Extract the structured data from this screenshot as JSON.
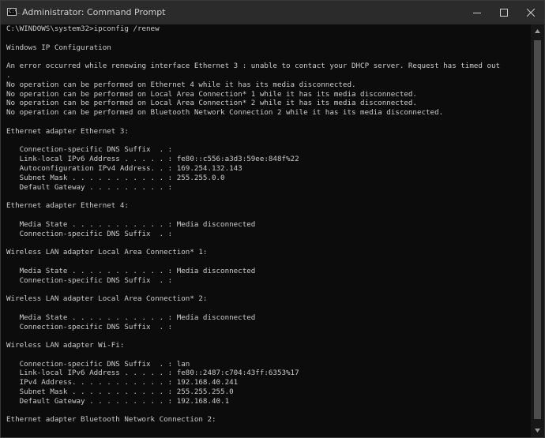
{
  "window": {
    "title": "Administrator: Command Prompt",
    "app_icon_glyph": "C:\\_",
    "icons": {
      "app": "command-prompt-icon",
      "minimize": "minimize-icon",
      "maximize": "maximize-icon",
      "close": "close-icon"
    }
  },
  "console": {
    "colors": {
      "background": "#0c0c0c",
      "text": "#cccccc",
      "titlebar": "#2b2b2b"
    },
    "lines": [
      "C:\\WINDOWS\\system32>ipconfig /renew",
      "",
      "Windows IP Configuration",
      "",
      "An error occurred while renewing interface Ethernet 3 : unable to contact your DHCP server. Request has timed out",
      ".",
      "No operation can be performed on Ethernet 4 while it has its media disconnected.",
      "No operation can be performed on Local Area Connection* 1 while it has its media disconnected.",
      "No operation can be performed on Local Area Connection* 2 while it has its media disconnected.",
      "No operation can be performed on Bluetooth Network Connection 2 while it has its media disconnected.",
      "",
      "Ethernet adapter Ethernet 3:",
      "",
      "   Connection-specific DNS Suffix  . :",
      "   Link-local IPv6 Address . . . . . : fe80::c556:a3d3:59ee:848f%22",
      "   Autoconfiguration IPv4 Address. . : 169.254.132.143",
      "   Subnet Mask . . . . . . . . . . . : 255.255.0.0",
      "   Default Gateway . . . . . . . . . :",
      "",
      "Ethernet adapter Ethernet 4:",
      "",
      "   Media State . . . . . . . . . . . : Media disconnected",
      "   Connection-specific DNS Suffix  . :",
      "",
      "Wireless LAN adapter Local Area Connection* 1:",
      "",
      "   Media State . . . . . . . . . . . : Media disconnected",
      "   Connection-specific DNS Suffix  . :",
      "",
      "Wireless LAN adapter Local Area Connection* 2:",
      "",
      "   Media State . . . . . . . . . . . : Media disconnected",
      "   Connection-specific DNS Suffix  . :",
      "",
      "Wireless LAN adapter Wi-Fi:",
      "",
      "   Connection-specific DNS Suffix  . : lan",
      "   Link-local IPv6 Address . . . . . : fe80::2487:c704:43ff:6353%17",
      "   IPv4 Address. . . . . . . . . . . : 192.168.40.241",
      "   Subnet Mask . . . . . . . . . . . : 255.255.255.0",
      "   Default Gateway . . . . . . . . . : 192.168.40.1",
      "",
      "Ethernet adapter Bluetooth Network Connection 2:"
    ]
  }
}
